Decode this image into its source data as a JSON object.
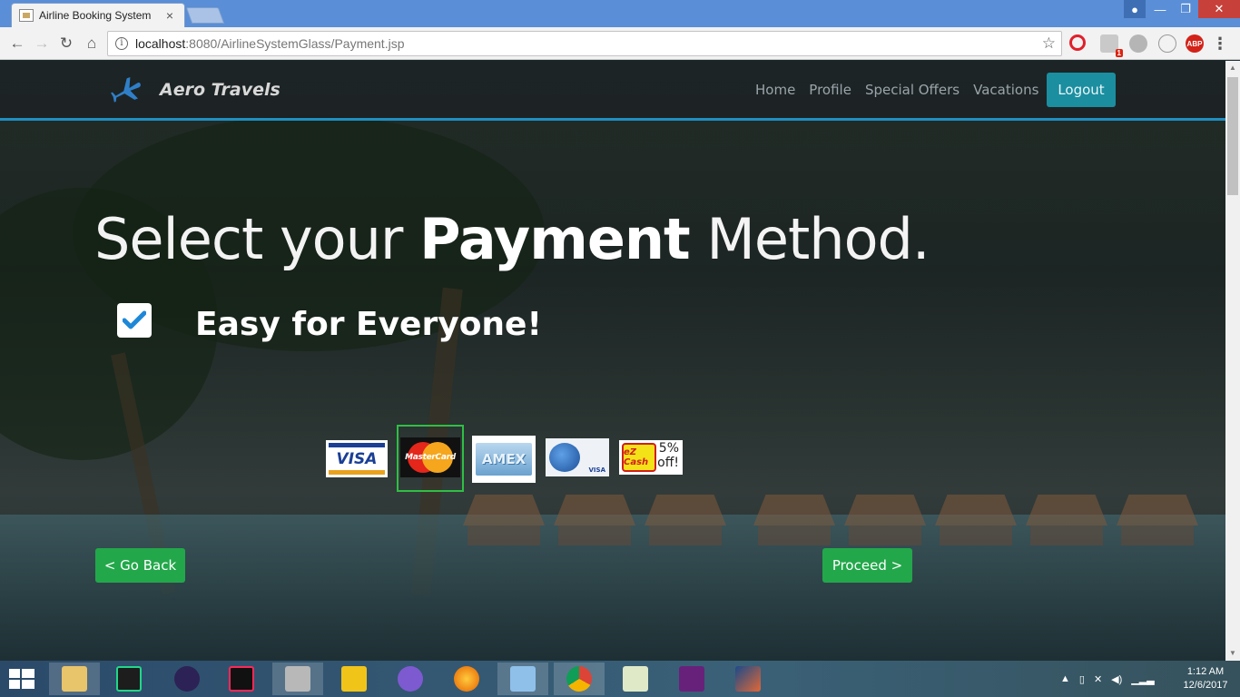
{
  "browser": {
    "tab_title": "Airline Booking System",
    "tab_close": "×",
    "url_host": "localhost",
    "url_rest": ":8080/AirlineSystemGlass/Payment.jsp",
    "info_glyph": "i",
    "star_glyph": "☆",
    "ext_shield_badge": "1",
    "ext_abp_label": "ABP",
    "menu_glyph": "⋮",
    "back_glyph": "←",
    "forward_glyph": "→",
    "reload_glyph": "↻",
    "home_glyph": "⌂",
    "min_glyph": "—",
    "max_glyph": "❐",
    "close_glyph": "✕",
    "user_glyph": "●"
  },
  "site": {
    "brand": "Aero Travels",
    "nav": [
      "Home",
      "Profile",
      "Special Offers",
      "Vacations"
    ],
    "logout": "Logout"
  },
  "hero": {
    "heading_part1": "Select your ",
    "heading_bold": "Payment",
    "heading_part2": " Method.",
    "subheading": "Easy for Everyone!"
  },
  "payment_cards": {
    "visa": "VISA",
    "mastercard": "MasterCard",
    "amex": "AMEX",
    "globe_visa": "VISA",
    "ezcash": "eZ Cash",
    "ezcash_offer_line1": "5%",
    "ezcash_offer_line2": "off!",
    "selected": "MasterCard"
  },
  "actions": {
    "back": "< Go Back",
    "proceed": "Proceed >"
  },
  "taskbar": {
    "time": "1:12 AM",
    "date": "12/6/2017",
    "apps": [
      "file-explorer",
      "pycharm",
      "eclipse",
      "intellij",
      "tools",
      "stack-builder",
      "gitkraken",
      "firefox",
      "virtualbox",
      "chrome",
      "notepad-plus-plus",
      "visual-studio",
      "matlab"
    ]
  },
  "colors": {
    "accent_nav_border": "#1f8fc2",
    "logout_bg": "#1b8ea0",
    "action_green": "#22a84a",
    "selection_border": "#2fbf45"
  }
}
